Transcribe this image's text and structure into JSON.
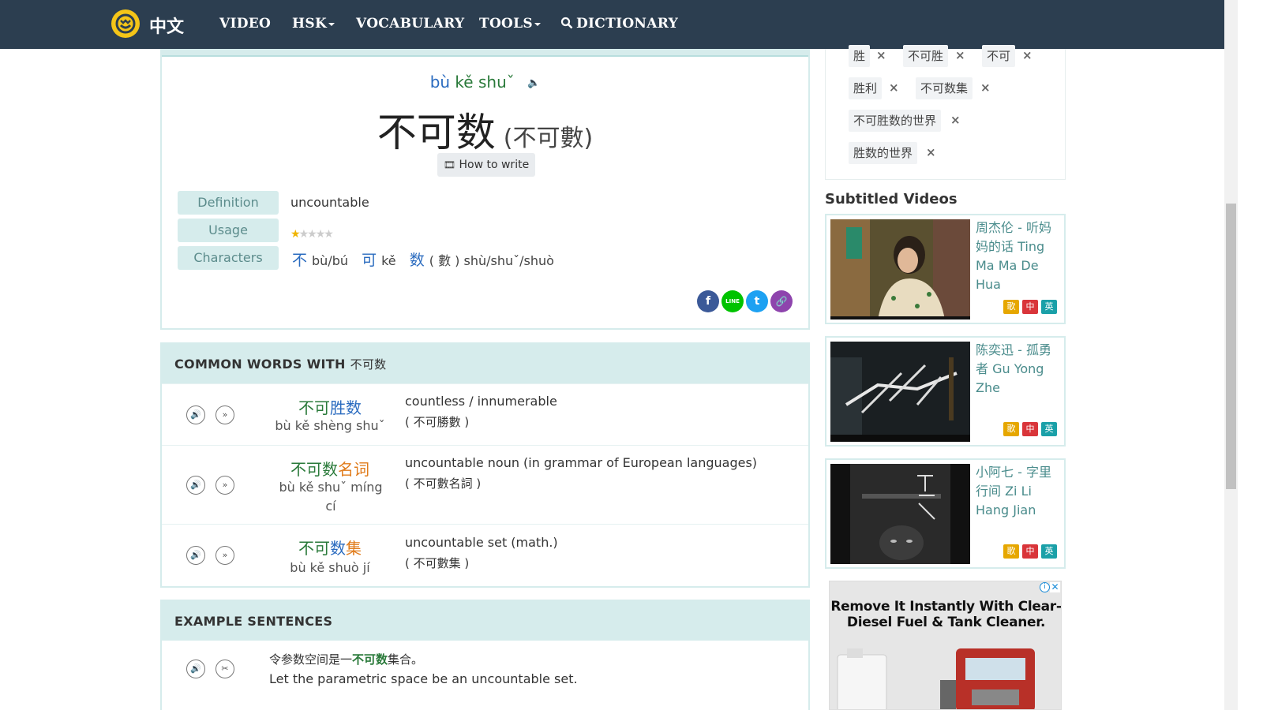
{
  "navbar": {
    "brand": "中文",
    "items": [
      {
        "label": "VIDEO"
      },
      {
        "label": "HSK"
      },
      {
        "label": "VOCABULARY"
      },
      {
        "label": "TOOLS"
      },
      {
        "label": "DICTIONARY"
      }
    ]
  },
  "entry": {
    "pinyin_bu": "bù",
    "pinyin_ke": "kě",
    "pinyin_shu": "shuˇ",
    "simplified": "不可数",
    "traditional": "(不可數)",
    "how_to_write": "How to write",
    "definition_label": "Definition",
    "definition": "uncountable",
    "usage_label": "Usage",
    "usage_stars": 1,
    "usage_max": 5,
    "characters_label": "Characters",
    "characters": [
      {
        "hz": "不",
        "py": "bù/bú"
      },
      {
        "hz": "可",
        "py": "kě"
      },
      {
        "hz": "数",
        "py": "( 數 ) shù/shuˇ/shuò"
      }
    ],
    "share": [
      "f",
      "LINE",
      "t",
      "🔗"
    ]
  },
  "common_words": {
    "heading": "COMMON WORDS WITH",
    "heading_hz": "不可数",
    "words": [
      {
        "hz_g": "不可",
        "hz_b": "胜数",
        "pinyin": "bù kě shèng shuˇ",
        "def": "countless / innumerable",
        "trad": "( 不可勝數 )"
      },
      {
        "hz_g": "不可数",
        "hz_o": "名词",
        "pinyin": "bù kě shuˇ míng cí",
        "def": "uncountable noun (in grammar of European languages)",
        "trad": "( 不可數名詞 )"
      },
      {
        "hz_g": "不可",
        "hz_b": "数",
        "hz_o": "集",
        "pinyin": "bù kě shuò jí",
        "def": "uncountable set (math.)",
        "trad": "( 不可數集 )"
      }
    ]
  },
  "examples": {
    "heading": "EXAMPLE SENTENCES",
    "items": [
      {
        "zh_before": "令参数空间是一",
        "zh_key": "不可数",
        "zh_after": "集合。",
        "en": "Let the parametric space be an uncountable set."
      }
    ]
  },
  "tags": [
    "胜",
    "不可胜",
    "不可",
    "胜利",
    "不可数集",
    "不可胜数的世界",
    "胜数的世界"
  ],
  "subtitled_videos": {
    "title": "Subtitled Videos",
    "videos": [
      {
        "title": "周杰伦 - 听妈妈的话 Ting Ma Ma De Hua",
        "badges": [
          "歌",
          "中",
          "英"
        ]
      },
      {
        "title": "陈奕迅 - 孤勇者 Gu Yong Zhe",
        "badges": [
          "歌",
          "中",
          "英"
        ]
      },
      {
        "title": "小阿七 - 字里行间 Zi Li Hang Jian",
        "badges": [
          "歌",
          "中",
          "英"
        ]
      }
    ]
  },
  "ad": {
    "text": "Remove It Instantly With Clear-Diesel Fuel & Tank Cleaner."
  },
  "colors": {
    "navbar": "#2c3e50",
    "accent_teal": "#d6ecec",
    "pinyin_green": "#2a7a3a",
    "pinyin_blue": "#2a6bbf",
    "orange": "#e07b1a"
  }
}
